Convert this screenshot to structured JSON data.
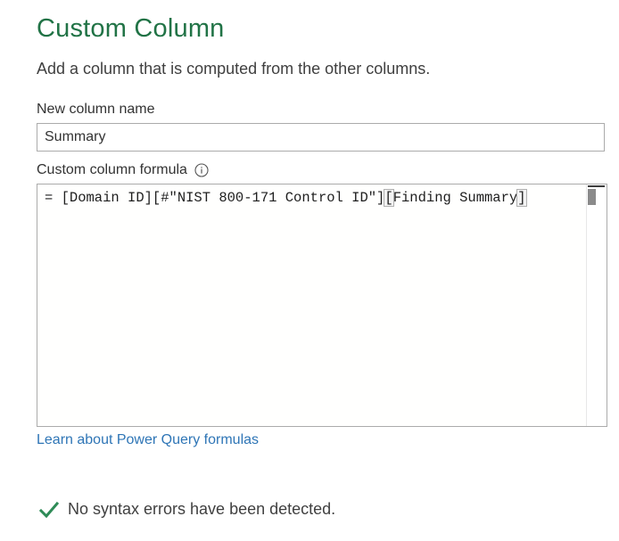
{
  "dialog": {
    "title": "Custom Column",
    "subtitle": "Add a column that is computed from the other columns."
  },
  "name_field": {
    "label": "New column name",
    "value": "Summary"
  },
  "formula_field": {
    "label": "Custom column formula",
    "info_icon": "info-icon",
    "prefix": "= [Domain ID][#\"NIST 800-171 Control ID\"]",
    "highlighted_open": "[",
    "middle": "Finding Summary",
    "highlighted_close": "]"
  },
  "help": {
    "link_text": "Learn about Power Query formulas"
  },
  "status": {
    "icon": "check-icon",
    "text": "No syntax errors have been detected.",
    "color": "#2e8b57"
  },
  "colors": {
    "title": "#217346",
    "link": "#2e75b6"
  }
}
